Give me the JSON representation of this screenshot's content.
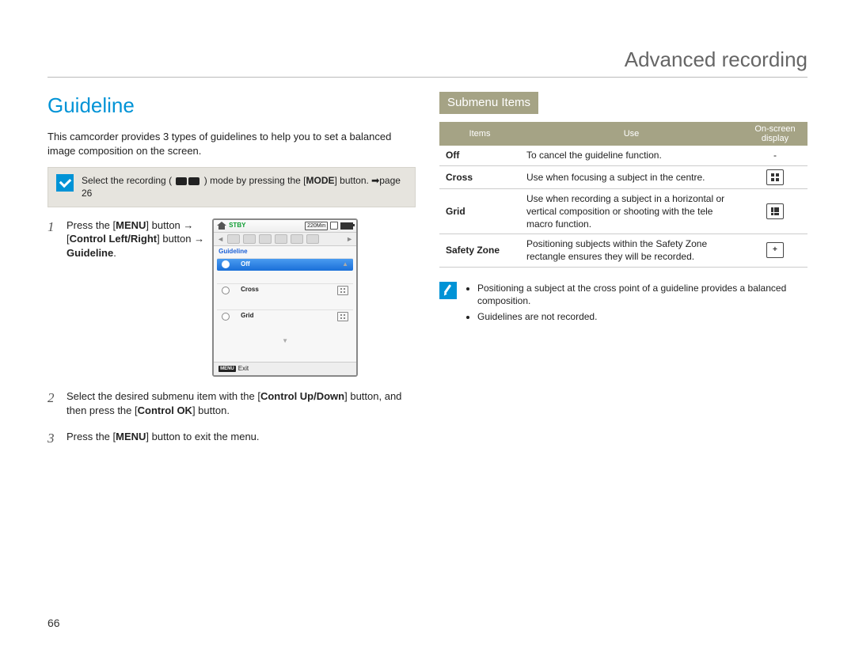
{
  "page_title": "Advanced recording",
  "page_number": "66",
  "left": {
    "heading": "Guideline",
    "intro": "This camcorder provides 3 types of guidelines to help you to set a balanced image composition on the screen.",
    "tip_before": "Select the recording (",
    "tip_after": ") mode by pressing the",
    "tip_mode": "MODE",
    "tip_end": "button. ",
    "tip_page": "page 26",
    "steps": {
      "s1_a": "Press the [",
      "s1_menu": "MENU",
      "s1_b": "] button ",
      "s1_arrow": "→",
      "s1_ctrl": "Control Left/Right",
      "s1_c": "] button ",
      "s1_guideline": "Guideline",
      "s2_a": "Select the desired submenu item with the [",
      "s2_ctrl1": "Control Up/Down",
      "s2_b": "] button, and then press the [",
      "s2_ctrl2": "Control OK",
      "s2_c": "] button.",
      "s3_a": "Press the [",
      "s3_menu": "MENU",
      "s3_b": "] button to exit the menu."
    },
    "lcd": {
      "stby": "STBY",
      "min": "220Min",
      "title": "Guideline",
      "items": [
        "Off",
        "Cross",
        "Grid"
      ],
      "exit_menu": "MENU",
      "exit_text": "Exit"
    }
  },
  "right": {
    "submenu_header": "Submenu Items",
    "cols": {
      "items": "Items",
      "use": "Use",
      "display": "On-screen display"
    },
    "rows": [
      {
        "name": "Off",
        "use": "To cancel the guideline function.",
        "icon": "dash"
      },
      {
        "name": "Cross",
        "use": "Use when focusing a subject in the centre.",
        "icon": "cross"
      },
      {
        "name": "Grid",
        "use": "Use when recording a subject in a horizontal or vertical composition or shooting with the tele macro function.",
        "icon": "grid"
      },
      {
        "name": "Safety Zone",
        "use": "Positioning subjects within the Safety Zone rectangle ensures they will be recorded.",
        "icon": "safety"
      }
    ],
    "notes": [
      "Positioning a subject at the cross point of a guideline provides a balanced composition.",
      "Guidelines are not recorded."
    ]
  }
}
